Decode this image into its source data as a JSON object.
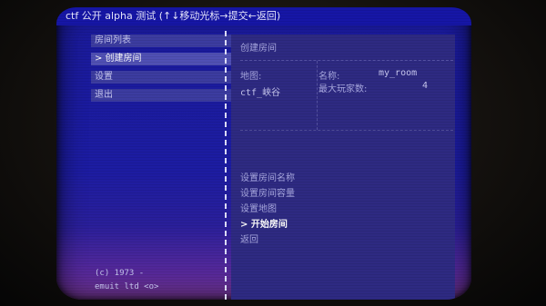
{
  "window": {
    "title": "ctf 公开 alpha 测试 (↑↓移动光标→提交←返回)"
  },
  "menu": {
    "items": [
      {
        "label": "房间列表"
      },
      {
        "label": "> 创建房间"
      },
      {
        "label": "设置"
      },
      {
        "label": "退出"
      }
    ]
  },
  "panel": {
    "title": "创建房间",
    "map_label": "地图:",
    "map_value": "ctf_峡谷",
    "name_label": "名称:",
    "name_value": "my_room",
    "max_players_label": "最大玩家数:",
    "max_players_value": "4",
    "actions": [
      {
        "label": "设置房间名称"
      },
      {
        "label": "设置房间容量"
      },
      {
        "label": "设置地图"
      },
      {
        "label": "> 开始房间"
      },
      {
        "label": "返回"
      }
    ]
  },
  "footer": {
    "line1": "(c) 1973 -",
    "line2": "emuit ltd <o>"
  },
  "colors": {
    "screen_blue": "#1c1ca2",
    "menu_item_bg": "#3c3ca0",
    "panel_bg": "#2e2a82",
    "text_light": "#c8c8f0"
  }
}
